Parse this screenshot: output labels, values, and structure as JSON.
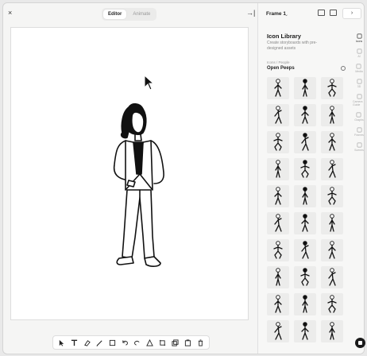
{
  "topbar": {
    "close_glyph": "×",
    "modes": [
      "Editor",
      "Animate"
    ],
    "active_mode": "Editor",
    "collapse_glyph": "→|"
  },
  "panel": {
    "frame_label": "Frame 1",
    "frame_chevron": "⌄",
    "go_glyph": "›",
    "title": "Icon Library",
    "description": "Create storyboards with pre-designed assets",
    "breadcrumb": "Icons / People",
    "library_name": "Open Peeps",
    "rail": [
      {
        "label": "Icons",
        "icon": "grid-icon"
      },
      {
        "label": "AI",
        "icon": "sparkle-icon"
      },
      {
        "label": "Media",
        "icon": "image-icon"
      },
      {
        "label": "3D",
        "icon": "cube-icon"
      },
      {
        "label": "Camera Guide",
        "icon": "camera-icon"
      },
      {
        "label": "Graphs",
        "icon": "chart-icon"
      },
      {
        "label": "Frames",
        "icon": "frame-icon"
      },
      {
        "label": "Scenes",
        "icon": "scene-icon"
      }
    ]
  },
  "toolbar": {
    "tools": [
      "select-tool",
      "text-tool",
      "eraser-tool",
      "brush-tool",
      "image-tool",
      "undo-tool",
      "redo-tool",
      "shape-tool",
      "crop-tool",
      "layers-tool",
      "duplicate-tool",
      "delete-tool"
    ]
  },
  "icon_count": 30
}
